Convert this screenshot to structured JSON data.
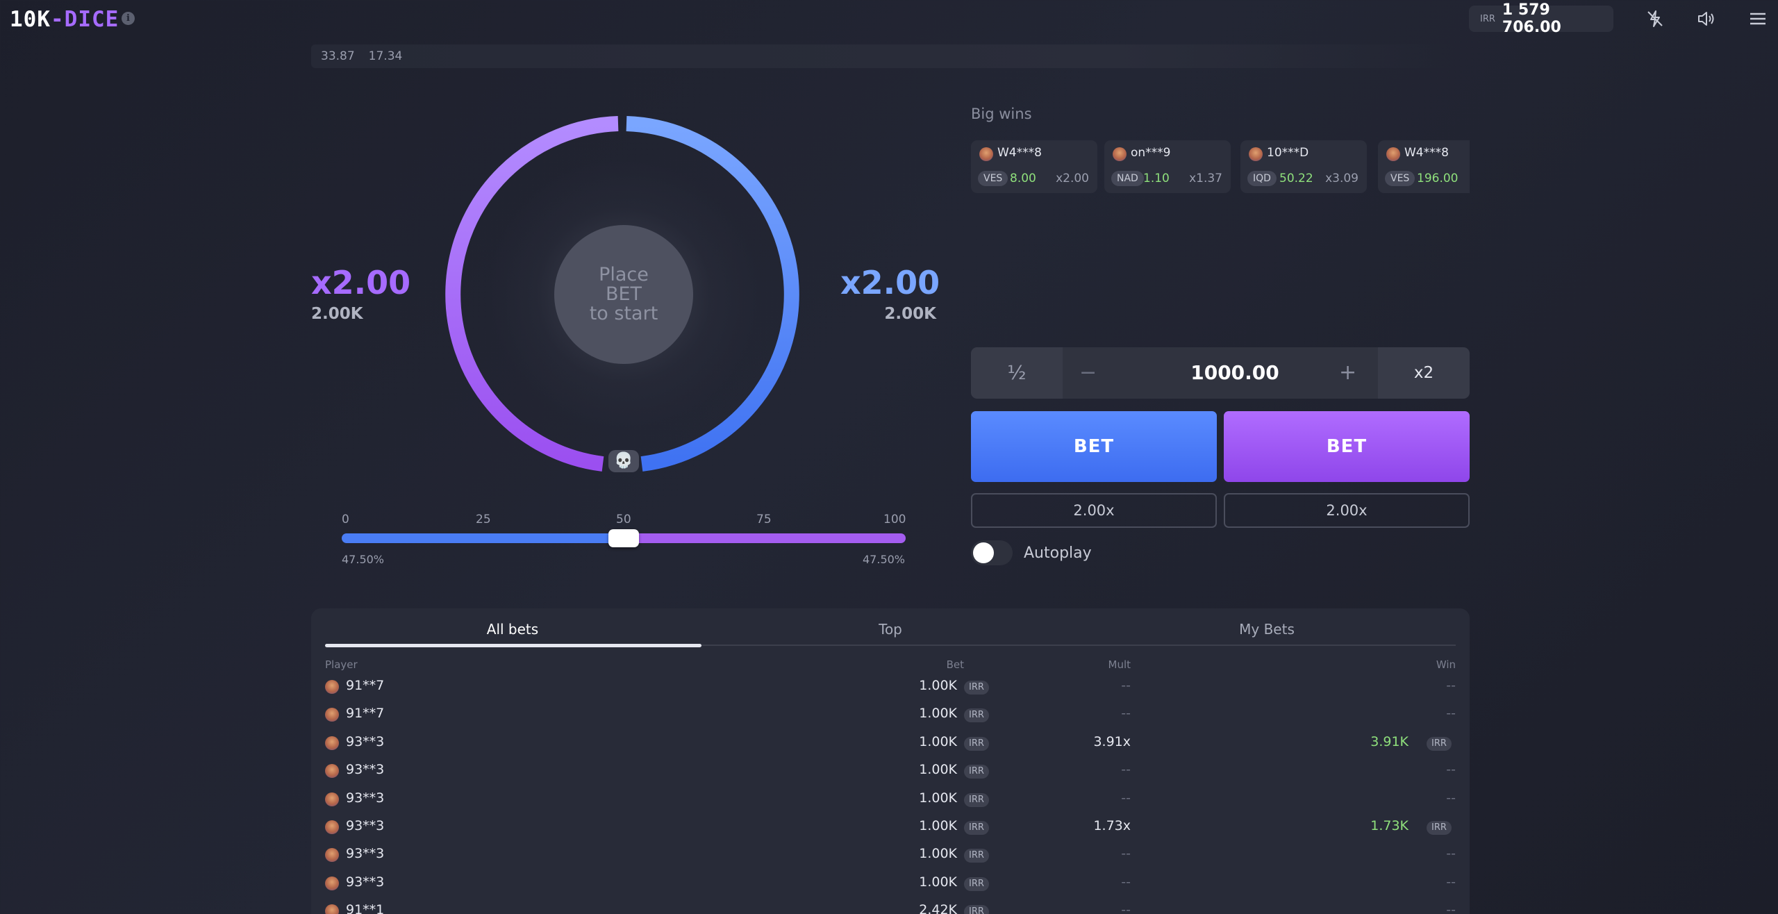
{
  "header": {
    "logo_part1": "10K",
    "logo_part2": "-DICE",
    "info_icon": "i",
    "balance_currency": "IRR",
    "balance_amount": "1 579 706.00",
    "icons": [
      "turbo-off-icon",
      "sound-icon",
      "menu-icon"
    ]
  },
  "history": [
    "33.87",
    "17.34"
  ],
  "game": {
    "left_multiplier": "x2.00",
    "left_payout": "2.00K",
    "right_multiplier": "x2.00",
    "right_payout": "2.00K",
    "center_text": [
      "Place",
      "BET",
      "to start"
    ],
    "left_color": "#a66bff",
    "right_color": "#7aa6ff",
    "slider_ticks": [
      "0",
      "25",
      "50",
      "75",
      "100"
    ],
    "slider_value": 50,
    "left_chance": "47.50%",
    "right_chance": "47.50%"
  },
  "big_wins": {
    "title": "Big wins",
    "items": [
      {
        "name": "W4***8",
        "currency": "VES",
        "win": "8.00",
        "mult": "x2.00"
      },
      {
        "name": "on***9",
        "currency": "NAD",
        "win": "1.10",
        "mult": "x1.37"
      },
      {
        "name": "10***D",
        "currency": "IQD",
        "win": "50.22",
        "mult": "x3.09"
      },
      {
        "name": "W4***8",
        "currency": "VES",
        "win": "196.00",
        "mult": ""
      }
    ]
  },
  "bet_controls": {
    "half_label": "½",
    "minus_label": "−",
    "amount": "1000.00",
    "plus_label": "+",
    "double_label": "x2",
    "bet_left_label": "BET",
    "bet_right_label": "BET",
    "payout_left": "2.00x",
    "payout_right": "2.00x",
    "autoplay_label": "Autoplay"
  },
  "bets_table": {
    "tabs": [
      "All bets",
      "Top",
      "My Bets"
    ],
    "headers": {
      "player": "Player",
      "bet": "Bet",
      "mult": "Mult",
      "win": "Win"
    },
    "rows": [
      {
        "player": "91**7",
        "bet": "1.00K",
        "currency": "IRR",
        "mult": "--",
        "win": "--",
        "win_currency": ""
      },
      {
        "player": "91**7",
        "bet": "1.00K",
        "currency": "IRR",
        "mult": "--",
        "win": "--",
        "win_currency": ""
      },
      {
        "player": "93**3",
        "bet": "1.00K",
        "currency": "IRR",
        "mult": "3.91x",
        "win": "3.91K",
        "win_currency": "IRR"
      },
      {
        "player": "93**3",
        "bet": "1.00K",
        "currency": "IRR",
        "mult": "--",
        "win": "--",
        "win_currency": ""
      },
      {
        "player": "93**3",
        "bet": "1.00K",
        "currency": "IRR",
        "mult": "--",
        "win": "--",
        "win_currency": ""
      },
      {
        "player": "93**3",
        "bet": "1.00K",
        "currency": "IRR",
        "mult": "1.73x",
        "win": "1.73K",
        "win_currency": "IRR"
      },
      {
        "player": "93**3",
        "bet": "1.00K",
        "currency": "IRR",
        "mult": "--",
        "win": "--",
        "win_currency": ""
      },
      {
        "player": "93**3",
        "bet": "1.00K",
        "currency": "IRR",
        "mult": "--",
        "win": "--",
        "win_currency": ""
      },
      {
        "player": "91**1",
        "bet": "2.42K",
        "currency": "IRR",
        "mult": "--",
        "win": "--",
        "win_currency": ""
      }
    ]
  }
}
